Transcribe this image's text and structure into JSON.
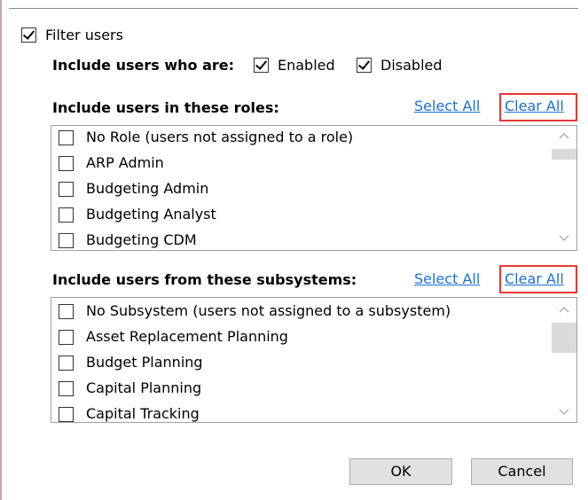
{
  "filter_users": {
    "label": "Filter users",
    "checked": true
  },
  "include_status": {
    "heading": "Include users who are:",
    "enabled": {
      "label": "Enabled",
      "checked": true
    },
    "disabled": {
      "label": "Disabled",
      "checked": true
    }
  },
  "roles": {
    "heading": "Include users in these roles:",
    "select_all": "Select All",
    "clear_all": "Clear All",
    "items": [
      {
        "label": "No Role (users not assigned to a role)",
        "checked": false
      },
      {
        "label": "ARP Admin",
        "checked": false
      },
      {
        "label": "Budgeting Admin",
        "checked": false
      },
      {
        "label": "Budgeting Analyst",
        "checked": false
      },
      {
        "label": "Budgeting CDM",
        "checked": false
      }
    ]
  },
  "subsystems": {
    "heading": "Include users from these subsystems:",
    "select_all": "Select All",
    "clear_all": "Clear All",
    "items": [
      {
        "label": "No Subsystem (users not assigned to a subsystem)",
        "checked": false
      },
      {
        "label": "Asset Replacement Planning",
        "checked": false
      },
      {
        "label": "Budget Planning",
        "checked": false
      },
      {
        "label": "Capital Planning",
        "checked": false
      },
      {
        "label": "Capital Tracking",
        "checked": false
      }
    ]
  },
  "buttons": {
    "ok": "OK",
    "cancel": "Cancel"
  },
  "colors": {
    "link": "#1a6fd6",
    "highlight": "#e53935"
  },
  "icons": {
    "scroll_up": "chevron-up-icon",
    "scroll_down": "chevron-down-icon"
  }
}
